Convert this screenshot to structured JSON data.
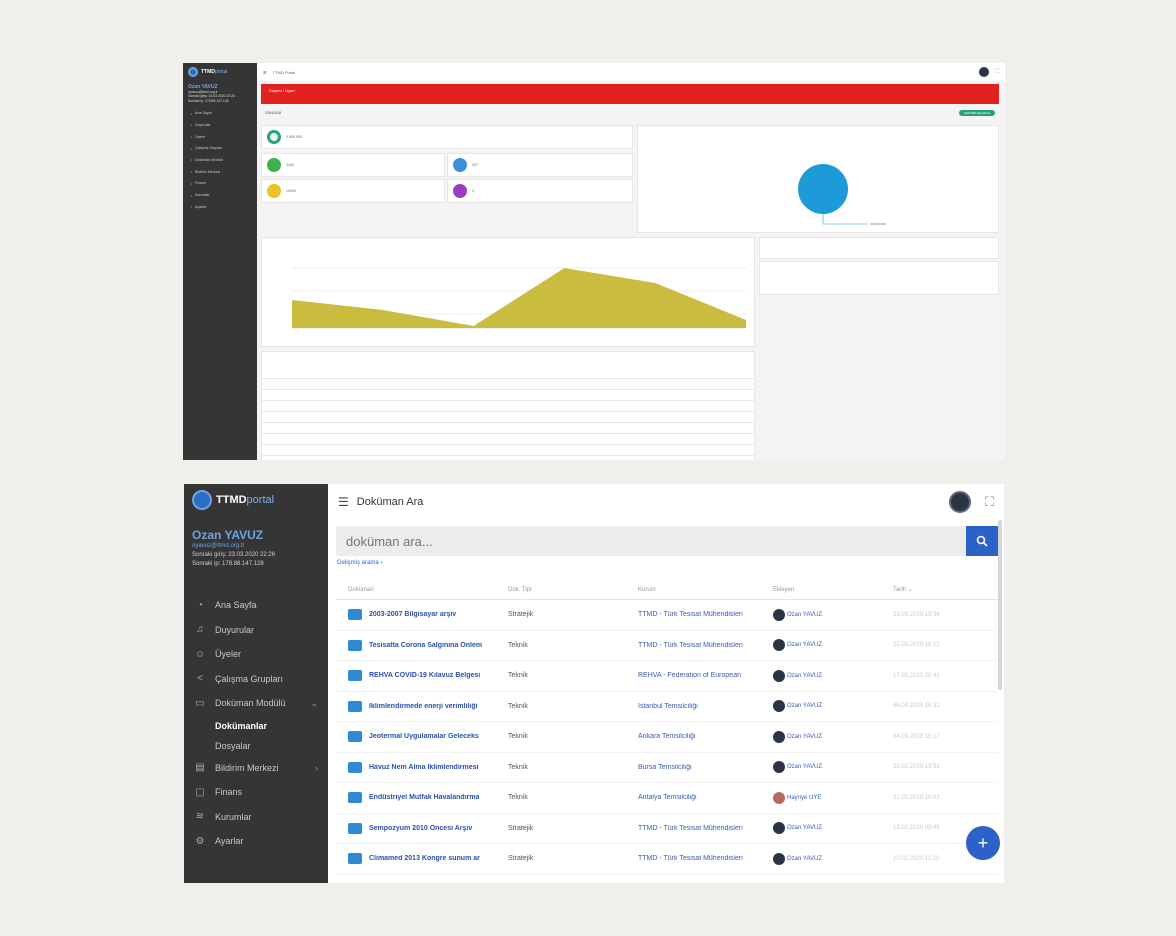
{
  "shot1": {
    "brand": {
      "bold": "TTMD",
      "rest": "portal"
    },
    "user": {
      "name": "Ozan YAVUZ",
      "email": "oyavuz@ttmd.org.tr",
      "line1": "Sonraki giriş: 23.03.2020 22:26",
      "line2": "Sonraki ip: 178.88.147.128"
    },
    "nav": [
      "Ana Sayfa",
      "Duyurular",
      "Üyeler",
      "Çalışma Grupları",
      "Doküman Modülü",
      "Bildirim Merkezi",
      "Finans",
      "Kurumlar",
      "Ayarlar"
    ],
    "topbar_title": "TTMD Portal",
    "alert_text": "Duyuru / Uyarı",
    "subbar": {
      "label": "GÜNDEM",
      "button": "YENİ BELGE EKLE"
    },
    "stats": [
      {
        "value": "2 800 000",
        "color": "#2aa080"
      },
      {
        "value": "2442",
        "color": "#3fb04a"
      },
      {
        "value": "437",
        "color": "#3c8fd8"
      },
      {
        "value": "19300",
        "color": "#ecc227"
      },
      {
        "value": "3",
        "color": "#9a3ec2"
      }
    ],
    "pie_color": "#1f9ad8",
    "area": {
      "values": [
        28,
        18,
        2,
        60,
        45,
        8
      ],
      "color": "#c9bc3f"
    },
    "right_panel_count": 2
  },
  "shot2": {
    "brand": {
      "bold": "TTMD",
      "rest": "portal"
    },
    "user": {
      "name": "Ozan YAVUZ",
      "email": "oyavuz@ttmd.org.tr",
      "line1": "Sonraki giriş: 23.03.2020 22:26",
      "line2": "Sonraki ip: 178.88.147.128"
    },
    "nav": {
      "home": "Ana Sayfa",
      "announcements": "Duyurular",
      "members": "Üyeler",
      "groups": "Çalışma Grupları",
      "doc_module": "Doküman Modülü",
      "documents": "Dokümanlar",
      "files": "Dosyalar",
      "notifications": "Bildirim Merkezi",
      "finance": "Finans",
      "institutions": "Kurumlar",
      "settings": "Ayarlar"
    },
    "topbar_title": "Doküman Ara",
    "search_placeholder": "doküman ara...",
    "advanced_search": "Gelişmiş arama ›",
    "columns": {
      "doc": "Doküman",
      "type": "Dok. Tipi",
      "inst": "Kurum",
      "uploader": "Ekleyen",
      "date": "Tarih ⌄"
    },
    "rows": [
      {
        "name": "2003-2007 Bilgisayar arşiv",
        "type": "Stratejik",
        "inst": "TTMD - Türk Tesisat Mühendisleri",
        "uploader": "Ozan YAVUZ",
        "date": "23.03.2020 19:36",
        "female": false
      },
      {
        "name": "Tesisatta Corona Salgınına Önlem",
        "type": "Teknik",
        "inst": "TTMD - Türk Tesisat Mühendisleri",
        "uploader": "Ozan YAVUZ",
        "date": "22.03.2020 18:12",
        "female": false
      },
      {
        "name": "REHVA COVID-19 Kılavuz Belgesi",
        "type": "Teknik",
        "inst": "REHVA - Federation of European",
        "uploader": "Ozan YAVUZ",
        "date": "17.03.2020 20:41",
        "female": false
      },
      {
        "name": "İklimlendirmede enerji verimliliği",
        "type": "Teknik",
        "inst": "İstanbul Temsilciliği",
        "uploader": "Ozan YAVUZ",
        "date": "06.03.2020 16:31",
        "female": false
      },
      {
        "name": "Jeotermal Uygulamalar Geleceks",
        "type": "Teknik",
        "inst": "Ankara Temsilciliği",
        "uploader": "Ozan YAVUZ",
        "date": "04.03.2020 15:17",
        "female": false
      },
      {
        "name": "Havuz Nem Alma İklimlendirmesi",
        "type": "Teknik",
        "inst": "Bursa Temsilciliği",
        "uploader": "Ozan YAVUZ",
        "date": "28.02.2020 13:51",
        "female": false
      },
      {
        "name": "Endüstriyel Mutfak Havalandırma",
        "type": "Teknik",
        "inst": "Antalya Temsilciliği",
        "uploader": "Hayriye UYE",
        "date": "21.02.2020 10:03",
        "female": true
      },
      {
        "name": "Sempozyum 2010 Öncesi Arşiv",
        "type": "Stratejik",
        "inst": "TTMD - Türk Tesisat Mühendisleri",
        "uploader": "Ozan YAVUZ",
        "date": "13.02.2020 09:45",
        "female": false
      },
      {
        "name": "Climamed 2013 Kongre sunum ar",
        "type": "Stratejik",
        "inst": "TTMD - Türk Tesisat Mühendisleri",
        "uploader": "Ozan YAVUZ",
        "date": "10.02.2020 11:22",
        "female": false
      }
    ]
  }
}
